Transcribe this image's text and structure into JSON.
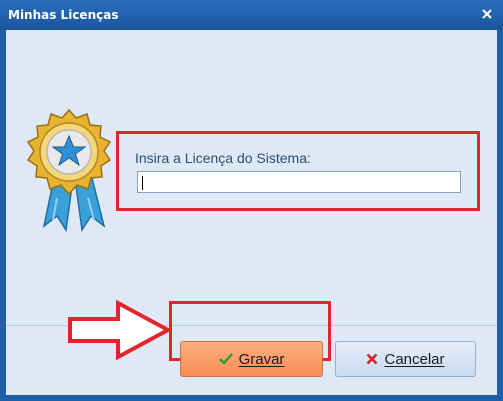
{
  "window": {
    "title": "Minhas Licenças"
  },
  "form": {
    "license_label": "Insira a Licença do Sistema:",
    "license_value": ""
  },
  "buttons": {
    "save_label": "Gravar",
    "cancel_label": "Cancelar"
  },
  "icons": {
    "award": "award-ribbon-icon",
    "save": "check-icon",
    "cancel": "x-icon",
    "close": "close-icon",
    "arrow": "arrow-right-annotation"
  },
  "colors": {
    "title_bar": "#1f5fa8",
    "annotation_red": "#e0262c",
    "save_button": "#f98c57",
    "cancel_button": "#c9d9ee"
  }
}
